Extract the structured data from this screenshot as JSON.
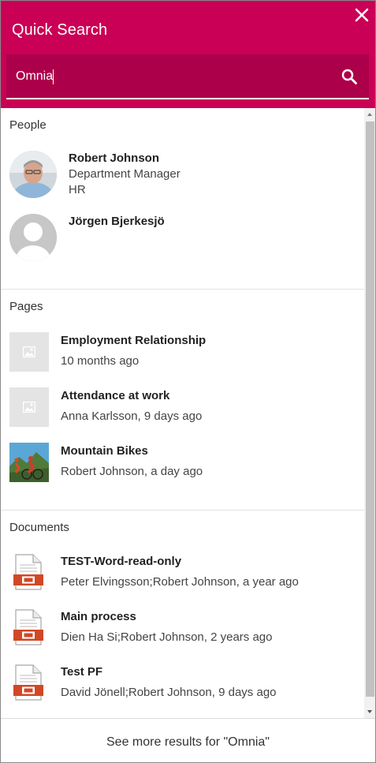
{
  "header": {
    "title": "Quick Search",
    "background": "#c90055",
    "close_icon": "close-icon"
  },
  "search": {
    "value": "Omnia",
    "placeholder": "",
    "icon": "search-icon"
  },
  "sections": {
    "people": {
      "title": "People",
      "items": [
        {
          "name": "Robert Johnson",
          "title": "Department Manager",
          "department": "HR",
          "avatar": "photo"
        },
        {
          "name": "Jörgen Bjerkesjö",
          "avatar": "default-avatar-icon"
        }
      ]
    },
    "pages": {
      "title": "Pages",
      "items": [
        {
          "title": "Employment Relationship",
          "subtitle": "10 months ago",
          "thumbnail": "image-placeholder-icon"
        },
        {
          "title": "Attendance at work",
          "subtitle": "Anna Karlsson, 9 days ago",
          "thumbnail": "image-placeholder-icon"
        },
        {
          "title": "Mountain Bikes",
          "subtitle": "Robert Johnson, a day ago",
          "thumbnail": "photo"
        }
      ]
    },
    "documents": {
      "title": "Documents",
      "items": [
        {
          "title": "TEST-Word-read-only",
          "subtitle": "Peter Elvingsson;Robert Johnson, a year ago",
          "icon": "presentation-file-icon"
        },
        {
          "title": "Main process",
          "subtitle": "Dien Ha Si;Robert Johnson, 2 years ago",
          "icon": "presentation-file-icon"
        },
        {
          "title": "Test PF",
          "subtitle": "David Jönell;Robert Johnson, 9 days ago",
          "icon": "presentation-file-icon"
        }
      ]
    }
  },
  "footer": {
    "see_more": "See more results for \"Omnia\""
  },
  "colors": {
    "accent": "#c90055",
    "search_bg": "#ad004a",
    "doc_icon": "#d24726"
  }
}
